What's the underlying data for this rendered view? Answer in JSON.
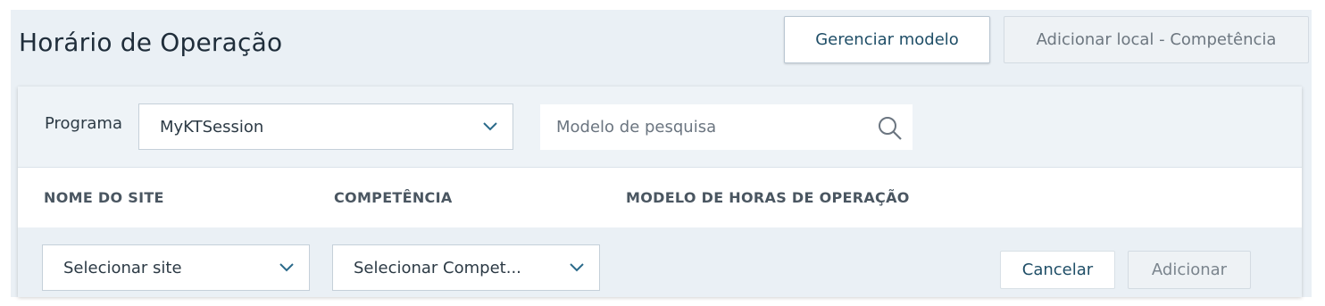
{
  "page": {
    "title": "Horário de Operação"
  },
  "header_actions": {
    "manage_template_label": "Gerenciar modelo",
    "add_site_skill_label": "Adicionar local - Competência"
  },
  "filters": {
    "program_label": "Programa",
    "program_value": "MyKTSession",
    "search_placeholder": "Modelo de pesquisa",
    "search_value": ""
  },
  "table": {
    "columns": [
      "NOME DO SITE",
      "COMPETÊNCIA",
      "MODELO DE HORAS DE OPERAÇÃO"
    ]
  },
  "new_row": {
    "site_select_value": "Selecionar site",
    "skill_select_value": "Selecionar Compet...",
    "cancel_label": "Cancelar",
    "add_label": "Adicionar"
  },
  "colors": {
    "background": "#eaf0f5",
    "primary_text": "#1f4e67",
    "disabled_text": "#6d7780",
    "chevron": "#2a6a8a"
  },
  "icons": {
    "program_chevron": "chevron-down-icon",
    "search": "search-icon",
    "site_chevron": "chevron-down-icon",
    "skill_chevron": "chevron-down-icon"
  }
}
